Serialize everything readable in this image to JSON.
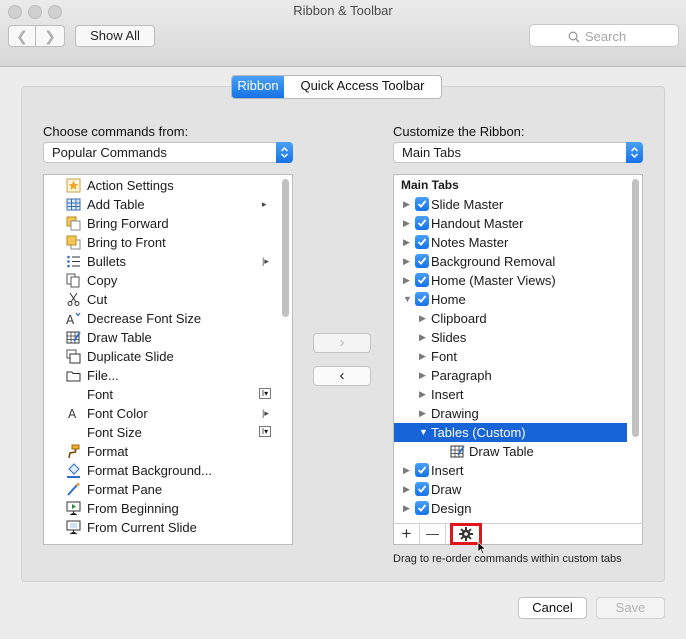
{
  "window": {
    "title": "Ribbon & Toolbar",
    "show_all_label": "Show All",
    "search_placeholder": "Search"
  },
  "tabs": [
    "Ribbon",
    "Quick Access Toolbar"
  ],
  "left": {
    "label": "Choose commands from:",
    "dropdown_value": "Popular Commands",
    "items": [
      {
        "label": "Action Settings",
        "icon": "star-icon"
      },
      {
        "label": "Add Table",
        "icon": "table-icon",
        "submenu": true
      },
      {
        "label": "Bring Forward",
        "icon": "bring-forward-icon"
      },
      {
        "label": "Bring to Front",
        "icon": "bring-front-icon"
      },
      {
        "label": "Bullets",
        "icon": "bullets-icon",
        "split": true
      },
      {
        "label": "Copy",
        "icon": "copy-icon"
      },
      {
        "label": "Cut",
        "icon": "scissors-icon"
      },
      {
        "label": "Decrease Font Size",
        "icon": "decrease-font-icon"
      },
      {
        "label": "Draw Table",
        "icon": "draw-table-icon"
      },
      {
        "label": "Duplicate Slide",
        "icon": "duplicate-icon"
      },
      {
        "label": "File...",
        "icon": "folder-icon"
      },
      {
        "label": "Font",
        "icon": "",
        "combo": true
      },
      {
        "label": "Font Color",
        "icon": "font-color-icon",
        "split": true
      },
      {
        "label": "Font Size",
        "icon": "",
        "combo": true
      },
      {
        "label": "Format",
        "icon": "format-painter-icon"
      },
      {
        "label": "Format Background...",
        "icon": "bucket-icon"
      },
      {
        "label": "Format Pane",
        "icon": "pane-icon"
      },
      {
        "label": "From Beginning",
        "icon": "slideshow-icon"
      },
      {
        "label": "From Current Slide",
        "icon": "slideshow-current-icon"
      }
    ]
  },
  "right": {
    "label": "Customize the Ribbon:",
    "dropdown_value": "Main Tabs",
    "header": "Main Tabs",
    "items": [
      {
        "label": "Slide Master",
        "level": 0,
        "checked": true,
        "expanded": false
      },
      {
        "label": "Handout Master",
        "level": 0,
        "checked": true,
        "expanded": false
      },
      {
        "label": "Notes Master",
        "level": 0,
        "checked": true,
        "expanded": false
      },
      {
        "label": "Background Removal",
        "level": 0,
        "checked": true,
        "expanded": false
      },
      {
        "label": "Home (Master Views)",
        "level": 0,
        "checked": true,
        "expanded": false
      },
      {
        "label": "Home",
        "level": 0,
        "checked": true,
        "expanded": true
      },
      {
        "label": "Clipboard",
        "level": 1,
        "expanded": false
      },
      {
        "label": "Slides",
        "level": 1,
        "expanded": false
      },
      {
        "label": "Font",
        "level": 1,
        "expanded": false
      },
      {
        "label": "Paragraph",
        "level": 1,
        "expanded": false
      },
      {
        "label": "Insert",
        "level": 1,
        "expanded": false
      },
      {
        "label": "Drawing",
        "level": 1,
        "expanded": false
      },
      {
        "label": "Tables (Custom)",
        "level": 1,
        "expanded": true,
        "selected": true
      },
      {
        "label": "Draw Table",
        "level": 2,
        "icon": "draw-table-icon"
      },
      {
        "label": "Insert",
        "level": 0,
        "checked": true,
        "expanded": false
      },
      {
        "label": "Draw",
        "level": 0,
        "checked": true,
        "expanded": false
      },
      {
        "label": "Design",
        "level": 0,
        "checked": true,
        "expanded": false
      }
    ],
    "footer_buttons": [
      "+",
      "—"
    ]
  },
  "hint": "Drag to re-order commands within custom tabs",
  "buttons": {
    "cancel": "Cancel",
    "save": "Save"
  },
  "colors": {
    "accent": "#1672e6",
    "selection": "#1764d6",
    "highlight_box": "#e0141c"
  }
}
